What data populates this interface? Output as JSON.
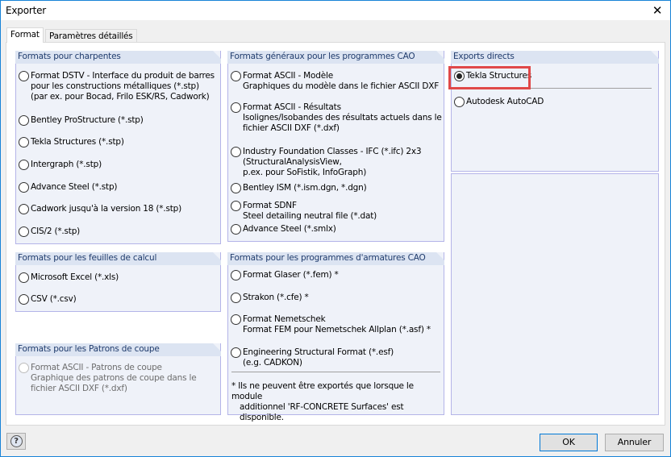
{
  "window": {
    "title": "Exporter",
    "close_icon": "close-icon"
  },
  "tabs": [
    {
      "label": "Format",
      "active": true
    },
    {
      "label": "Paramètres détaillés",
      "active": false
    }
  ],
  "groups": {
    "charpentes": {
      "title": "Formats pour charpentes",
      "items": [
        [
          "Format DSTV - Interface du produit de barres",
          "pour les constructions métalliques (*.stp)",
          "(par ex. pour Bocad, Frilo ESK/RS, Cadwork)"
        ],
        [
          "Bentley ProStructure (*.stp)"
        ],
        [
          "Tekla Structures (*.stp)"
        ],
        [
          "Intergraph (*.stp)"
        ],
        [
          "Advance Steel (*.stp)"
        ],
        [
          "Cadwork jusqu'à la version 18 (*.stp)"
        ],
        [
          "CIS/2 (*.stp)"
        ]
      ]
    },
    "calcul": {
      "title": "Formats pour les feuilles de calcul",
      "items": [
        [
          "Microsoft Excel (*.xls)"
        ],
        [
          "CSV (*.csv)"
        ]
      ]
    },
    "patrons": {
      "title": "Formats pour les Patrons de coupe",
      "items": [
        [
          "Format ASCII - Patrons de coupe",
          "Graphique des patrons de coupe dans le",
          "fichier ASCII DXF (*.dxf)"
        ]
      ],
      "disabled": true
    },
    "cao": {
      "title": "Formats généraux pour les programmes CAO",
      "items": [
        [
          "Format ASCII - Modèle",
          "Graphiques du modèle dans le fichier ASCII DXF"
        ],
        [
          "Format ASCII - Résultats",
          "Isolignes/Isobandes des résultats actuels dans le",
          "fichier ASCII DXF (*.dxf)"
        ],
        [
          "Industry Foundation Classes - IFC (*.ifc) 2x3",
          "(StructuralAnalysisView,",
          "p.ex. pour SoFistik, InfoGraph)"
        ],
        [
          "Bentley ISM (*.ism.dgn, *.dgn)"
        ],
        [
          "Format SDNF",
          "Steel detailing neutral file (*.dat)"
        ],
        [
          "Advance Steel (*.smlx)"
        ]
      ]
    },
    "armatures": {
      "title": "Formats pour les programmes d'armatures CAO",
      "items": [
        [
          "Format Glaser (*.fem)  *"
        ],
        [
          "Strakon (*.cfe)  *"
        ],
        [
          "Format Nemetschek",
          "Format FEM pour Nemetschek Allplan (*.asf)  *"
        ],
        [
          "Engineering Structural Format (*.esf)",
          "(e.g. CADKON)"
        ]
      ],
      "note": [
        "*  Ils ne peuvent être exportés que lorsque le module",
        "additionnel 'RF-CONCRETE Surfaces' est disponible."
      ]
    },
    "directs": {
      "title": "Exports directs",
      "items": [
        [
          "Tekla Structures"
        ],
        [
          "Autodesk AutoCAD"
        ]
      ],
      "selected": "Tekla Structures"
    }
  },
  "buttons": {
    "ok": "OK",
    "cancel": "Annuler",
    "help_icon": "help-icon"
  },
  "colors": {
    "highlight": "#e04848",
    "group_header": "#dce4f2",
    "accent": "#0078d7"
  }
}
